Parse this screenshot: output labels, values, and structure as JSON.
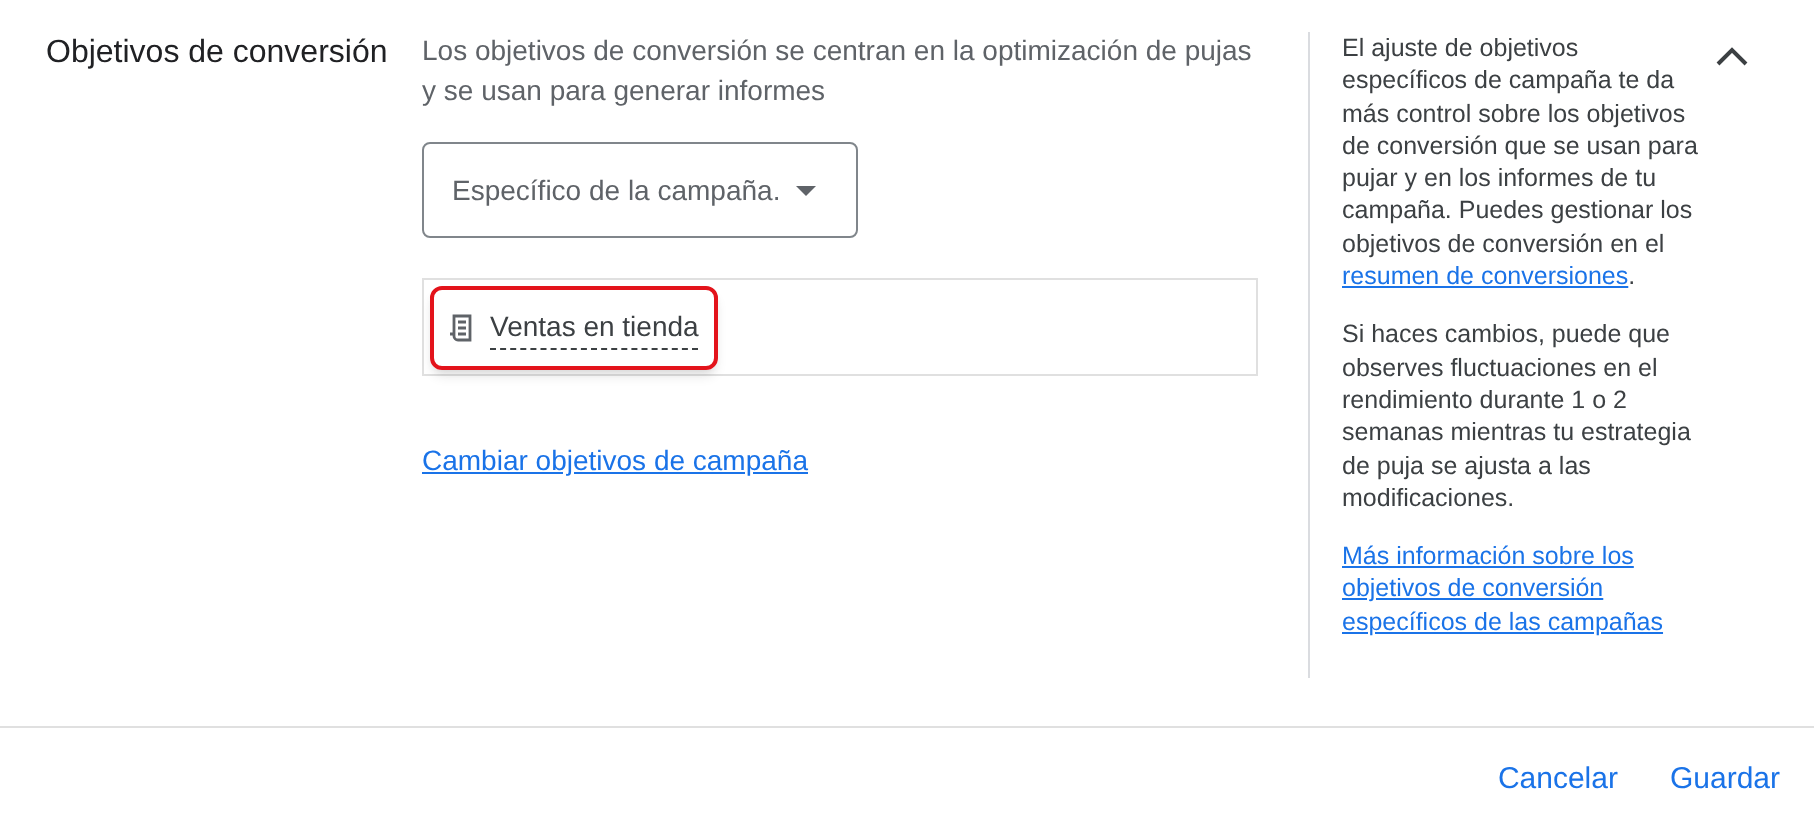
{
  "section": {
    "title": "Objetivos de conversión",
    "expanded": true
  },
  "description": "Los objetivos de conversión se centran en la optimización de pujas y se usan para generar informes",
  "dropdown": {
    "value": "Específico de la campaña."
  },
  "goals": [
    {
      "label": "Ventas en tienda",
      "highlighted": true
    }
  ],
  "change_link": "Cambiar objetivos de campaña",
  "help": {
    "paragraph_1": {
      "text": "El ajuste de objetivos específicos de campaña te da más control sobre los objetivos de conversión que se usan para pujar y en los informes de tu campaña. Puedes gestionar los objetivos de conversión en el ",
      "link": "resumen de conversiones",
      "after": "."
    },
    "paragraph_2": "Si haces cambios, puede que observes fluctuaciones en el rendimiento durante 1 o 2 semanas mientras tu estrategia de puja se ajusta a las modificaciones.",
    "more_link": "Más información sobre los objetivos de conversión específicos de las campañas"
  },
  "buttons": [
    "Cancelar",
    "Guardar"
  ]
}
